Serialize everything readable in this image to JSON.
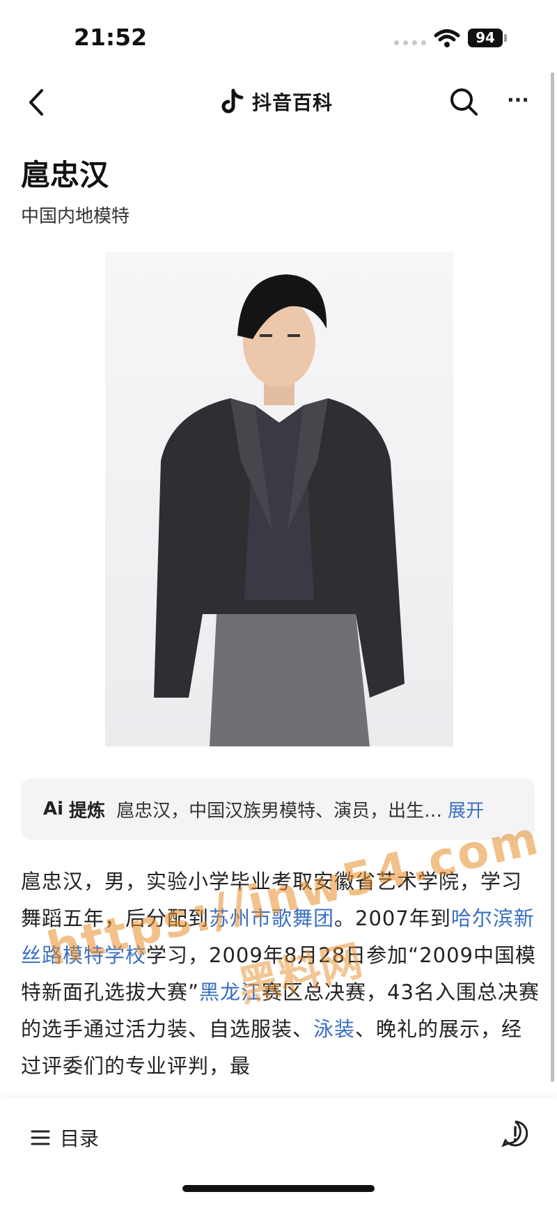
{
  "status_bar": {
    "time": "21:52",
    "battery": "94"
  },
  "nav": {
    "brand": "抖音百科"
  },
  "entry": {
    "title": "扈忠汉",
    "subtitle": "中国内地模特"
  },
  "ai_summary": {
    "badge": "Ai",
    "label": "提炼",
    "text": "扈忠汉，中国汉族男模特、演员，出生…",
    "expand": "展开"
  },
  "article": {
    "p1_a": "扈忠汉，男，实验小学毕业考取安徽省艺术学院，学习舞蹈五年，后分配到",
    "link1": "苏州市歌舞团",
    "p1_b": "。2007年到",
    "link2": "哈尔滨新丝路模特学校",
    "p1_c": "学习，2009年8月28日参加“2009中国模特新面孔选拔大赛”",
    "link3": "黑龙江",
    "p1_d": "赛区总决赛，43名入围总决赛的选手通过活力装、自选服装、",
    "link4": "泳装",
    "p1_e": "、晚礼的展示，经过评委们的专业评判，最"
  },
  "watermark": {
    "line1": "https://inw54.com",
    "line2": "黑料网"
  },
  "bottom_bar": {
    "toc_label": "目录"
  }
}
